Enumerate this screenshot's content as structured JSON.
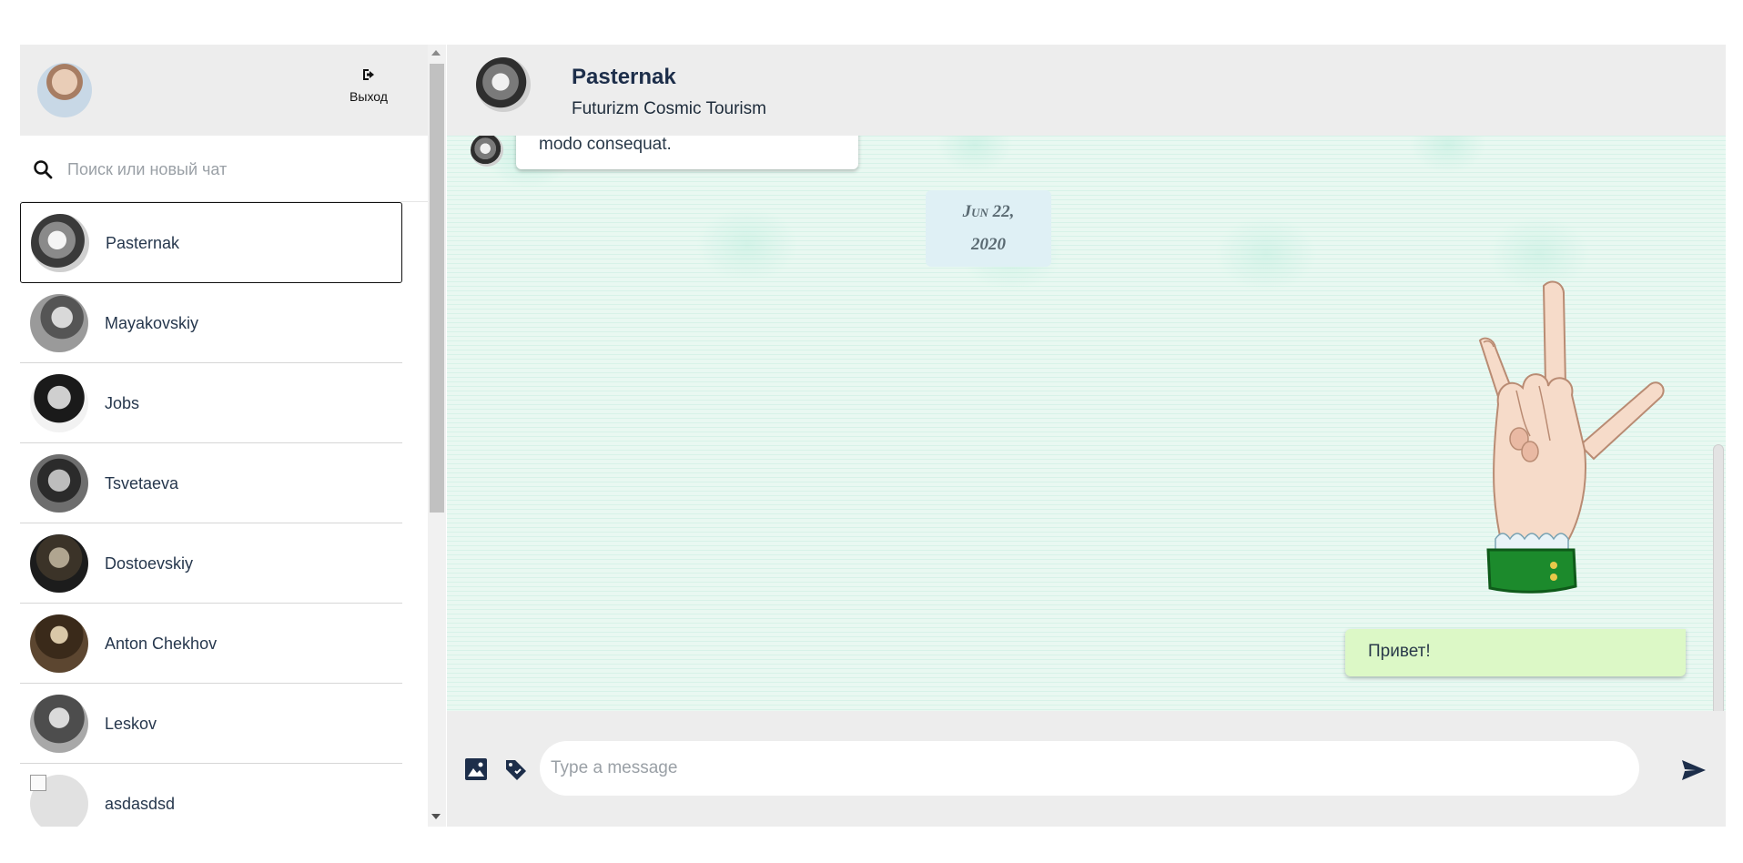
{
  "user": {
    "logout_label": "Выход",
    "logout_icon": "sign-out-icon"
  },
  "search": {
    "placeholder": "Поиск или новый чат",
    "icon": "search-icon"
  },
  "contacts": [
    {
      "name": "Pasternak",
      "active": true
    },
    {
      "name": "Mayakovskiy"
    },
    {
      "name": "Jobs"
    },
    {
      "name": "Tsvetaeva"
    },
    {
      "name": "Dostoevskiy"
    },
    {
      "name": "Anton Chekhov"
    },
    {
      "name": "Leskov"
    },
    {
      "name": "asdasdsd"
    }
  ],
  "chat": {
    "name": "Pasternak",
    "subtitle": "Futurizm Cosmic Tourism",
    "incoming_message": "modo consequat.",
    "date_line1": "Jun 22,",
    "date_line2": "2020",
    "outgoing_message": "Привет!"
  },
  "composer": {
    "placeholder": "Type a message",
    "image_icon": "image-icon",
    "sticker_icon": "tag-icon",
    "send_icon": "send-icon"
  },
  "colors": {
    "outgoing_bubble": "#dcf8c6",
    "incoming_bubble": "#ffffff",
    "date_chip": "#dff0f5",
    "header_bg": "#ededed",
    "accent": "#1d2e4a"
  }
}
